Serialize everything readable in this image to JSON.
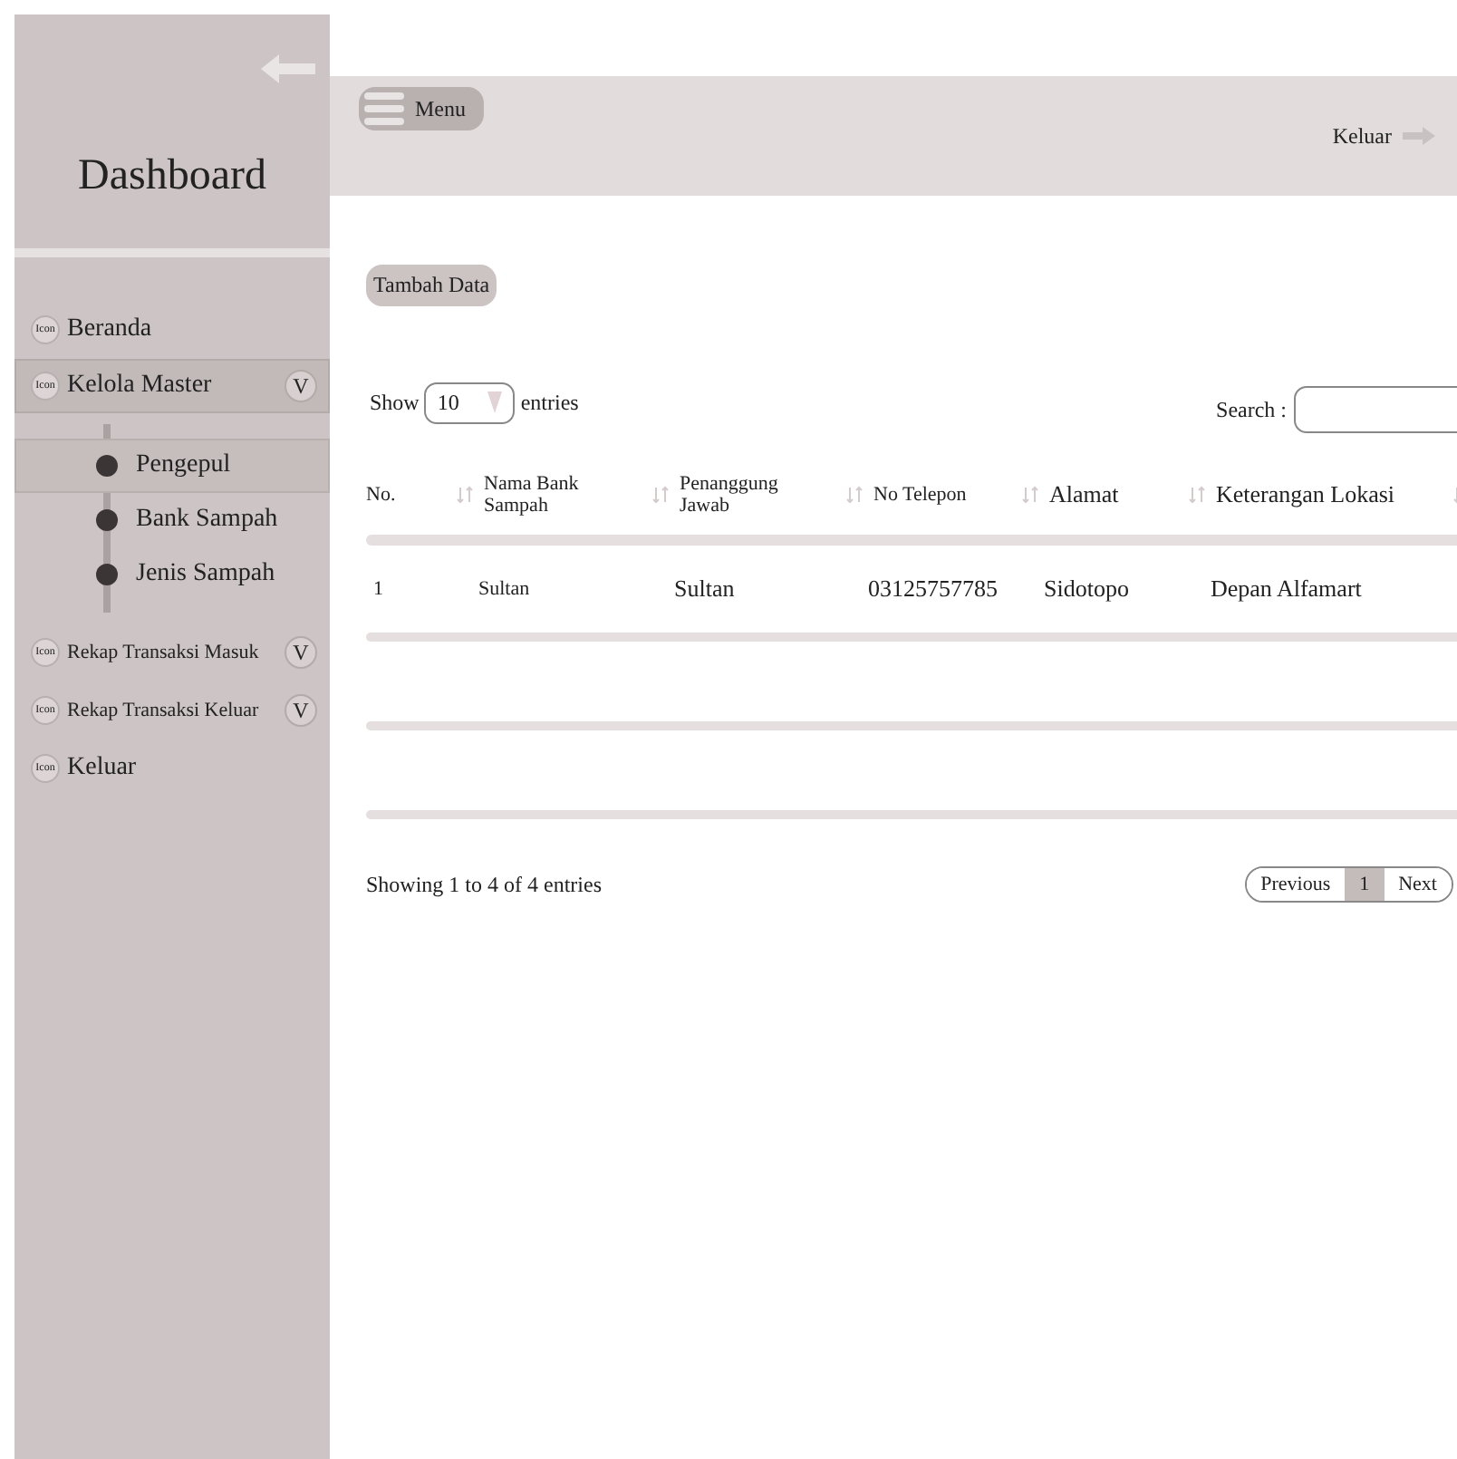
{
  "sidebar": {
    "title": "Dashboard",
    "items": [
      {
        "icon_label": "Icon",
        "label": "Beranda",
        "selected": false,
        "small": false
      },
      {
        "icon_label": "Icon",
        "label": "Kelola Master",
        "selected": true,
        "small": false,
        "toggle": "V",
        "expanded": true,
        "children": [
          {
            "label": "Pengepul",
            "selected": true
          },
          {
            "label": "Bank Sampah",
            "selected": false
          },
          {
            "label": "Jenis Sampah",
            "selected": false
          }
        ]
      },
      {
        "icon_label": "Icon",
        "label": "Rekap Transaksi Masuk",
        "selected": false,
        "small": true,
        "toggle": "V"
      },
      {
        "icon_label": "Icon",
        "label": "Rekap Transaksi Keluar",
        "selected": false,
        "small": true,
        "toggle": "V"
      },
      {
        "icon_label": "Icon",
        "label": "Keluar",
        "selected": false,
        "small": false
      }
    ]
  },
  "header": {
    "menu_label": "Menu",
    "logout_label": "Keluar"
  },
  "add_button": "Tambah Data",
  "length": {
    "show": "Show",
    "value": "10",
    "entries": "entries"
  },
  "search": {
    "label": "Search :"
  },
  "table": {
    "columns": [
      "No.",
      "Nama Bank Sampah",
      "Penanggung Jawab",
      "No Telepon",
      "Alamat",
      "Keterangan Lokasi"
    ],
    "rows": [
      [
        "1",
        "Sultan",
        "Sultan",
        "03125757785",
        "Sidotopo",
        "Depan Alfamart"
      ]
    ]
  },
  "footer": {
    "info": "Showing 1 to 4 of 4 entries",
    "pages": [
      {
        "label": "Previous",
        "selected": false
      },
      {
        "label": "1",
        "selected": true
      },
      {
        "label": "Next",
        "selected": false
      }
    ]
  }
}
